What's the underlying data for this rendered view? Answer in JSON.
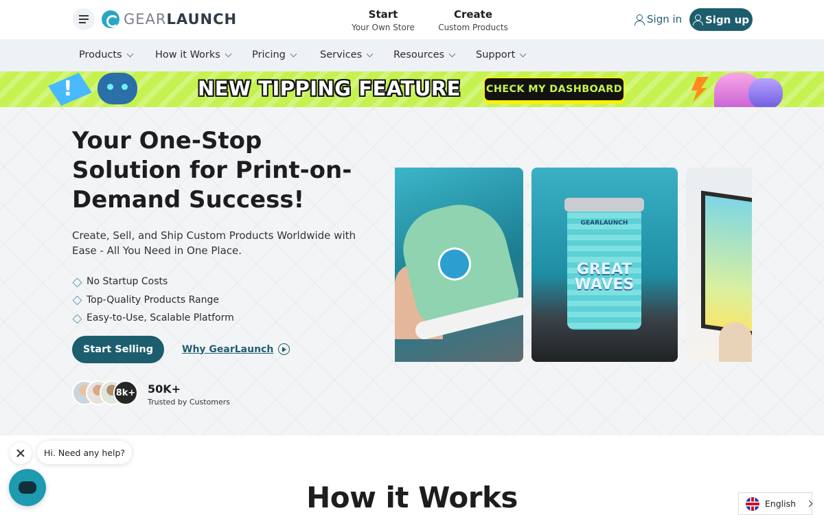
{
  "header": {
    "logo_light": "GEAR",
    "logo_bold": "LAUNCH",
    "links": [
      {
        "title": "Start",
        "subtitle": "Your Own Store"
      },
      {
        "title": "Create",
        "subtitle": "Custom Products"
      }
    ],
    "sign_in": "Sign in",
    "sign_up": "Sign up"
  },
  "nav": {
    "items": [
      "Products",
      "How it Works",
      "Pricing",
      "Services",
      "Resources",
      "Support"
    ]
  },
  "banner": {
    "title": "NEW TIPPING FEATURE",
    "cta": "CHECK MY DASHBOARD"
  },
  "hero": {
    "title": "Your One-Stop Solution for Print-on-Demand Success!",
    "subtitle": "Create, Sell, and Ship Custom Products Worldwide with Ease - All You Need in One Place.",
    "features": [
      "No Startup Costs",
      "Top-Quality Products Range",
      "Easy-to-Use, Scalable Platform"
    ],
    "primary_button": "Start Selling",
    "secondary_link": "Why GearLaunch",
    "avatar_count": "8k+",
    "trust_number": "50K+",
    "trust_label": "Trusted by Customers",
    "product_tumbler_brand": "GEARLAUNCH",
    "product_tumbler_text": "GREAT WAVES"
  },
  "chat": {
    "message": "Hi. Need any help?"
  },
  "how_it_works": {
    "title": "How it Works"
  },
  "language": {
    "selected": "English"
  },
  "colors": {
    "brand_primary": "#1c5d6e",
    "banner_green": "#c5f250",
    "chat_accent": "#1e9ab1"
  }
}
